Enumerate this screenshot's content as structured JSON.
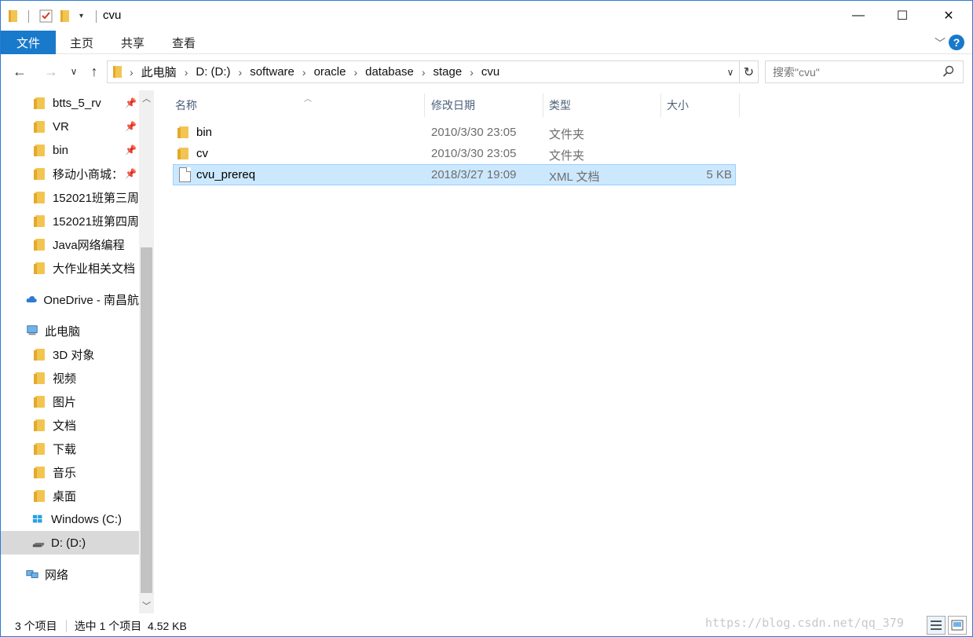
{
  "window": {
    "title": "cvu",
    "minimize_glyph": "—",
    "maximize_glyph": "☐",
    "close_glyph": "✕"
  },
  "ribbon": {
    "tabs": [
      "文件",
      "主页",
      "共享",
      "查看"
    ],
    "help_label": "?"
  },
  "nav": {
    "back_glyph": "←",
    "forward_glyph": "→",
    "recent_glyph": "∨",
    "up_glyph": "↑",
    "breadcrumbs": [
      "此电脑",
      "D: (D:)",
      "software",
      "oracle",
      "database",
      "stage",
      "cvu"
    ],
    "breadcrumb_separator": "›",
    "refresh_glyph": "↻",
    "search_placeholder": "搜索\"cvu\"",
    "search_icon": "search-icon"
  },
  "sidebar": {
    "quick_access": [
      {
        "label": "btts_5_rv",
        "pinned": true
      },
      {
        "label": "VR",
        "pinned": true
      },
      {
        "label": "bin",
        "pinned": true
      },
      {
        "label": "移动小商城：",
        "pinned": true
      },
      {
        "label": "152021班第三周",
        "pinned": false
      },
      {
        "label": "152021班第四周",
        "pinned": false
      },
      {
        "label": "Java网络编程",
        "pinned": false
      },
      {
        "label": "大作业相关文档",
        "pinned": false
      }
    ],
    "onedrive": "OneDrive - 南昌航",
    "this_pc": "此电脑",
    "pc_items": [
      "3D 对象",
      "视频",
      "图片",
      "文档",
      "下载",
      "音乐",
      "桌面",
      "Windows (C:)",
      "D: (D:)"
    ],
    "network": "网络",
    "selected": "D: (D:)"
  },
  "columns": {
    "name": "名称",
    "modified": "修改日期",
    "type": "类型",
    "size": "大小"
  },
  "files": [
    {
      "name": "bin",
      "modified": "2010/3/30 23:05",
      "type": "文件夹",
      "size": "",
      "kind": "folder",
      "selected": false
    },
    {
      "name": "cv",
      "modified": "2010/3/30 23:05",
      "type": "文件夹",
      "size": "",
      "kind": "folder",
      "selected": false
    },
    {
      "name": "cvu_prereq",
      "modified": "2018/3/27 19:09",
      "type": "XML 文档",
      "size": "5 KB",
      "kind": "file",
      "selected": true
    }
  ],
  "status": {
    "item_count": "3 个项目",
    "selection": "选中 1 个项目  4.52 KB"
  },
  "watermark": "https://blog.csdn.net/qq_379",
  "colors": {
    "accent": "#1979ca",
    "selection_bg": "#cce8ff",
    "selection_border": "#99d1ff",
    "folder": "#f2c552"
  }
}
